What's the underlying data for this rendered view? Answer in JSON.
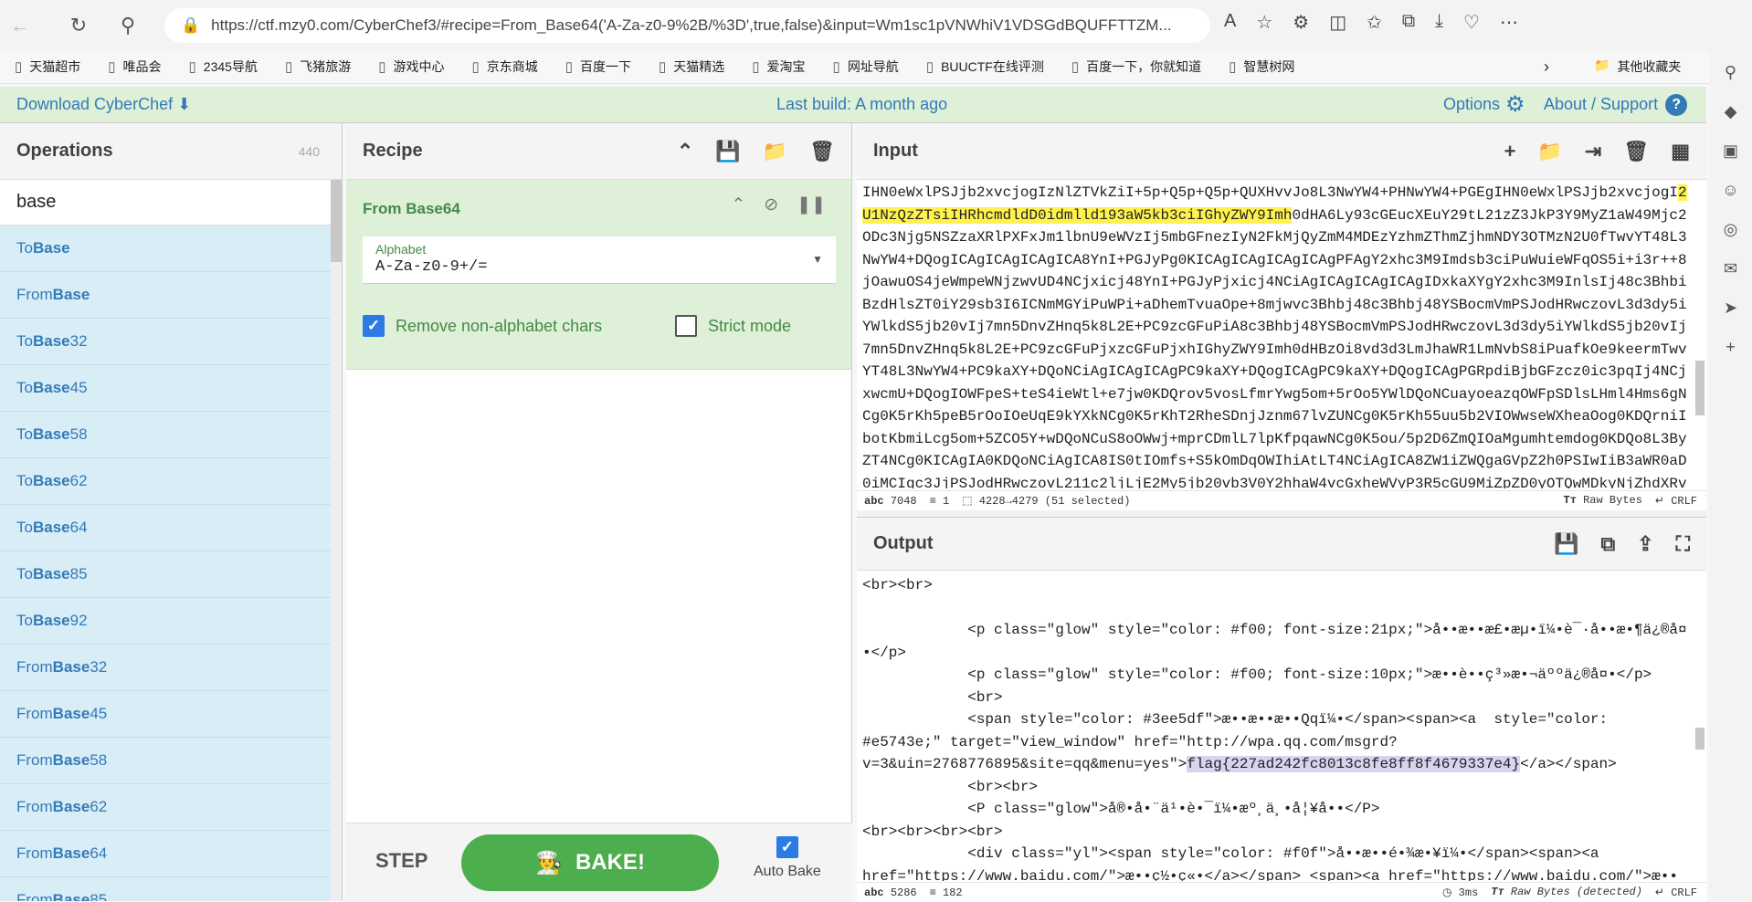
{
  "browser": {
    "url": "https://ctf.mzy0.com/CyberChef3/#recipe=From_Base64('A-Za-z0-9%2B/%3D',true,false)&input=Wm1sc1pVNWhiV1VDSGdBQUFFTTZM...",
    "bookmarks": [
      "天猫超市",
      "唯品会",
      "2345导航",
      "飞猪旅游",
      "游戏中心",
      "京东商城",
      "百度一下",
      "天猫精选",
      "爱淘宝",
      "网址导航",
      "BUUCTF在线评测",
      "百度一下，你就知道",
      "智慧树网"
    ],
    "other_bookmarks": "其他收藏夹"
  },
  "header": {
    "download": "Download CyberChef",
    "last_build": "Last build: A month ago",
    "options": "Options",
    "about": "About / Support"
  },
  "operations": {
    "title": "Operations",
    "count": "440",
    "search_value": "base",
    "items": [
      {
        "pre": "To ",
        "b": "Base"
      },
      {
        "pre": "From ",
        "b": "Base"
      },
      {
        "pre": "To ",
        "b": "Base",
        "post": "32"
      },
      {
        "pre": "To ",
        "b": "Base",
        "post": "45"
      },
      {
        "pre": "To ",
        "b": "Base",
        "post": "58"
      },
      {
        "pre": "To ",
        "b": "Base",
        "post": "62"
      },
      {
        "pre": "To ",
        "b": "Base",
        "post": "64"
      },
      {
        "pre": "To ",
        "b": "Base",
        "post": "85"
      },
      {
        "pre": "To ",
        "b": "Base",
        "post": "92"
      },
      {
        "pre": "From ",
        "b": "Base",
        "post": "32"
      },
      {
        "pre": "From ",
        "b": "Base",
        "post": "45"
      },
      {
        "pre": "From ",
        "b": "Base",
        "post": "58"
      },
      {
        "pre": "From ",
        "b": "Base",
        "post": "62"
      },
      {
        "pre": "From ",
        "b": "Base",
        "post": "64"
      },
      {
        "pre": "From ",
        "b": "Base",
        "post": "85"
      }
    ]
  },
  "recipe": {
    "title": "Recipe",
    "operation": "From Base64",
    "alphabet_label": "Alphabet",
    "alphabet_value": "A-Za-z0-9+/=",
    "remove_non_alpha": {
      "label": "Remove non-alphabet chars",
      "checked": true
    },
    "strict_mode": {
      "label": "Strict mode",
      "checked": false
    },
    "step": "STEP",
    "bake": "BAKE!",
    "auto_bake": {
      "label": "Auto Bake",
      "checked": true
    }
  },
  "input": {
    "title": "Input",
    "text_before": "IHN0eWxlPSJjb2xvcjogIzNlZTVkZiI+5p+Q5p+Q5p+QUXHvvJo8L3NwYW4+PHNwYW4+PGEgIHN0eWxlPSJjb2xvcjogI",
    "text_highlight": "2U1NzQzZTsiIHRhcmdldD0idmlld193aW5kb3ciIGhyZWY9Imh",
    "text_after": "0dHA6Ly93cGEucXEuY29tL21zZ3JkP3Y9MyZ1aW49Mjc2ODc3Njg5NSZzaXRlPXFxJm1lbnU9eWVzIj5mbGFnezIyN2FkMjQyZmM4MDEzYzhmZThmZjhmNDY3OTMzN2U0fTwvYT48L3NwYW4+DQogICAgICAgICAgICA8YnI+PGJyPg0KICAgICAgICAgICAgPFAgY2xhc3M9Imdsb3ciPuWuieWFqOS5i+i3r++8jOawuOS4jeWmpeWNjzwvUD4NCjxicj48YnI+PGJyPjxicj4NCiAgICAgICAgICAgIDxkaXYgY2xhc3M9InlsIj48c3Bhbi BzdHlsZT0iY29sb3I6ICNmMGYiPuWPi+aDhemTvuaOpe+8mjwvc3Bhbj48c3Bhbj48YSBocmVmPSJodHRwczovL3d3dy5iYWlkdS5jb20vIj7mn5DnvZHnq5k8L2E+PC9zcGFuPiA8c3Bhbj48YSBocmVmPSJodHRwczovL3d3dy5iYWlkdS5jb20vIj7mn5DnvZHnq5k8L2E+PC9zcGFuPjxzcGFuPjxhIGhyZWY9Imh0dHBzOi8vd3d3LmJhaWR1LmNvbS8iPuafkOe9keermTwvYT48L3NwYW4+PC9kaXY+DQoNCiAgICAgICAgPC9kaXY+DQogICAgPC9kaXY+DQogICAgPGRpdiBjbGFzcz0ic3pqIj4NCjxwcmU+DQogIOWFpeS+teS4ieWtl+e7jw0KDQrov5vosLfmrYwg5om+5rOo5YWlDQoNCuayoeazqOWFpSDlsLHml4Hms6gNCg0K5rKh5peB5rOoIOeUqE9kYXkNCg0K5rKhT2RheSDnjJznm67lvZUNCg0K5rKh55uu5b2VIOWwseWXheaOog0KDQrniIbotKbmiLcg5om+5ZCO5Y+wDQoNCuS8oOWwj+mprCDmlL7lpKfpqawNCg0K5ou/5p2D6ZmQIOaMgumhtemdog0KDQo8L3ByZT4NCg0KICAgIA0KDQoNCiAgICA8IS0tIOmfs+S5kOmDqOWIhiAtLT4NCiAgICA8ZW1iZWQgaGVpZ2h0PSIwIiB3aWR0aD0iMCIgc3JjPSJodHRwczovL211c2ljLjE2My5jb20vb3V0Y2hhaW4vcGxheWVyP3R5cGU9MiZpZD0yOTQwMDkyNjZhdXRv",
    "stats": {
      "length": "7048",
      "lines": "1",
      "selection": "4228→4279 (51 selected)",
      "encoding": "Raw Bytes",
      "eol": "CRLF"
    }
  },
  "output": {
    "title": "Output",
    "lines": [
      {
        "t": "<br><br>"
      },
      {
        "t": ""
      },
      {
        "t": "            <p class=\"glow\" style=\"color: #f00; font-size:21px;\">å••æ••æ£•æµ•ï¼•è¯·å••æ•¶ä¿®å¤"
      },
      {
        "t": "•</p>"
      },
      {
        "t": "            <p class=\"glow\" style=\"color: #f00; font-size:10px;\">æ••è••ç³»æ•¬äººä¿®å¤•</p>"
      },
      {
        "t": "            <br>"
      },
      {
        "t": "            <span style=\"color: #3ee5df\">æ••æ••æ••Qqï¼•</span><span><a  style=\"color:"
      },
      {
        "t": "#e5743e;\" target=\"view_window\" href=\"http://wpa.qq.com/msgrd?"
      },
      {
        "t": "v=3&uin=2768776895&site=qq&menu=yes\">",
        "sel": "flag{227ad242fc8013c8fe8ff8f4679337e4}",
        "after": "</a></span>"
      },
      {
        "t": "            <br><br>"
      },
      {
        "t": "            <P class=\"glow\">å®•å•¨ä¹•è•¯ï¼•æº¸ä¸•å¦¥å••</P>"
      },
      {
        "t": "<br><br><br><br>"
      },
      {
        "t": "            <div class=\"yl\"><span style=\"color: #f0f\">å••æ••é•¾æ•¥ï¼•</span><span><a"
      },
      {
        "t": "href=\"https://www.baidu.com/\">æ••ç½•ç«•</a></span> <span><a href=\"https://www.baidu.com/\">æ••"
      }
    ],
    "stats": {
      "length": "5286",
      "lines": "182",
      "time": "3ms",
      "encoding": "Raw Bytes (detected)",
      "eol": "CRLF"
    }
  },
  "colors": {
    "header_bg": "#dff0d8",
    "op_bg": "#d9edf7",
    "link": "#337ab7",
    "bake": "#4cae4c",
    "highlight": "#fff24f",
    "selection": "#d7d4f0"
  }
}
